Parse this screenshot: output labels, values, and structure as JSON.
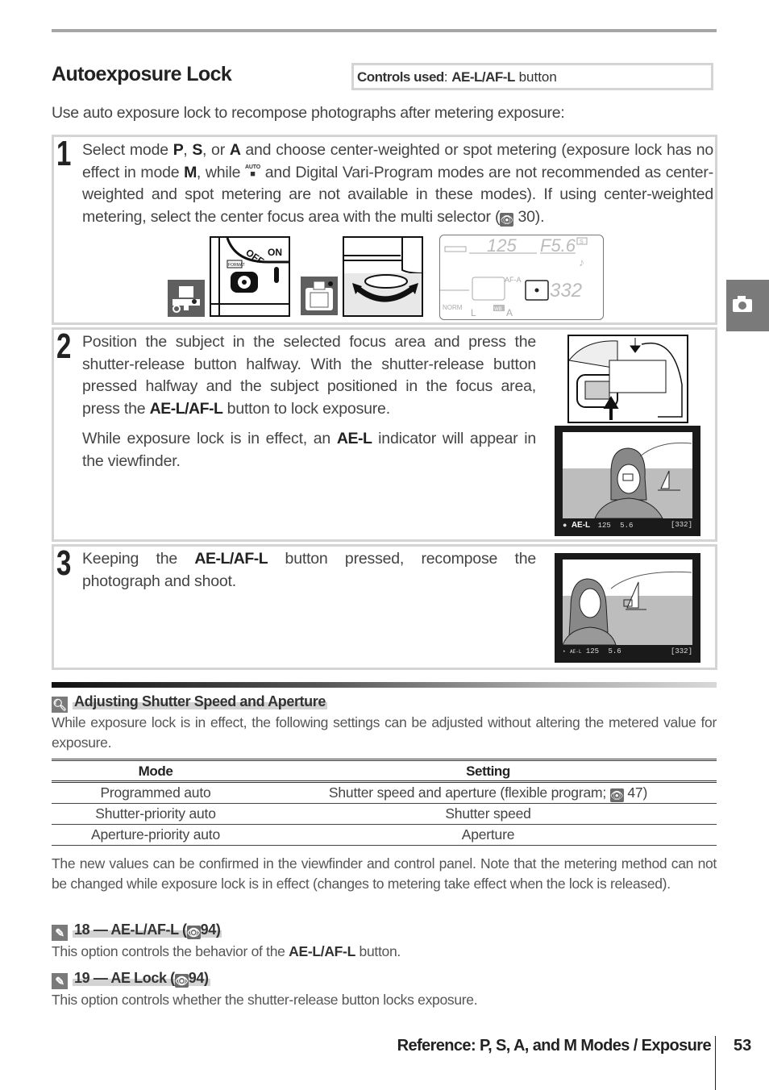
{
  "header": {
    "title": "Autoexposure Lock",
    "controls_label": "Controls used",
    "controls_sep": ": ",
    "controls_button": "AE-L/AF-L",
    "controls_suffix": " button"
  },
  "intro": "Use auto exposure lock to recompose photographs after metering exposure:",
  "steps": [
    {
      "number": "1",
      "segments": [
        {
          "t": "Select mode "
        },
        {
          "b": "P"
        },
        {
          "t": ", "
        },
        {
          "b": "S"
        },
        {
          "t": ", or "
        },
        {
          "b": "A"
        },
        {
          "t": " and choose center-weighted or spot metering (exposure lock has no effect in mode "
        },
        {
          "b": "M"
        },
        {
          "t": ", while "
        },
        {
          "icon": "auto-mode-icon",
          "glyph": "AUTO"
        },
        {
          "t": " and Digital Vari-Program modes are not recommended as center-weighted and spot metering are not available in these modes).  If using center-weighted metering, select the center focus area with the multi selector ("
        },
        {
          "ref": "30"
        },
        {
          "t": ")."
        }
      ],
      "figures": {
        "control_panel": {
          "shutter": "125",
          "aperture": "F5.6",
          "mode": "S",
          "af_mode": "AF-A",
          "frames": "332",
          "quality": "NORM",
          "size": "L",
          "wb_label": "WB",
          "wb": "A",
          "power_off": "OFF",
          "power_on": "ON",
          "format_label": "FORMAT"
        }
      }
    },
    {
      "number": "2",
      "para1": [
        {
          "t": "Position the subject in the selected focus area and press the shutter-release button halfway.  With the shutter-release button pressed halfway and the subject positioned in the focus area, press the "
        },
        {
          "b": "AE-L/AF-L"
        },
        {
          "t": " button to lock exposure."
        }
      ],
      "para2": [
        {
          "t": "While exposure lock is in effect, an "
        },
        {
          "b": "AE-L"
        },
        {
          "t": " indicator will appear in the viewfinder."
        }
      ],
      "viewfinder": {
        "indicator": "AE-L",
        "shutter": "125",
        "aperture": "5.6",
        "frames": "[332]"
      }
    },
    {
      "number": "3",
      "segments": [
        {
          "t": "Keeping the "
        },
        {
          "b": "AE-L/AF-L"
        },
        {
          "t": " button pressed, recompose the photograph and shoot."
        }
      ],
      "viewfinder": {
        "indicator": "AE-L",
        "shutter": "125",
        "aperture": "5.6",
        "frames": "[332]"
      }
    }
  ],
  "tip": {
    "title": "Adjusting Shutter Speed and Aperture",
    "body": "While exposure lock is in effect, the following settings can be adjusted without altering the metered value for exposure.",
    "table": {
      "headers": [
        "Mode",
        "Setting"
      ],
      "rows": [
        {
          "mode": "Programmed auto",
          "setting": "Shutter speed and aperture (flexible program; ",
          "ref": "47",
          "suffix": ")"
        },
        {
          "mode": "Shutter-priority auto",
          "setting": "Shutter speed"
        },
        {
          "mode": "Aperture-priority auto",
          "setting": "Aperture"
        }
      ]
    },
    "after": "The new values can be confirmed in the viewfinder and control panel.  Note that the metering method can not be changed while exposure lock is in effect (changes to metering take effect when the lock is released)."
  },
  "custom_settings": [
    {
      "title": "18 — AE-L/AF-L (",
      "ref": "94",
      "close": ")",
      "desc_pre": "This option controls the behavior of the ",
      "desc_bold": "AE-L/AF-L",
      "desc_post": " button."
    },
    {
      "title": "19 — AE Lock (",
      "ref": "94",
      "close": ")",
      "desc": "This option controls whether the shutter-release button locks exposure."
    }
  ],
  "footer": {
    "section": "Reference: P, S, A, and M Modes / Exposure",
    "page": "53"
  },
  "side_tab": {
    "icon": "camera-icon"
  }
}
